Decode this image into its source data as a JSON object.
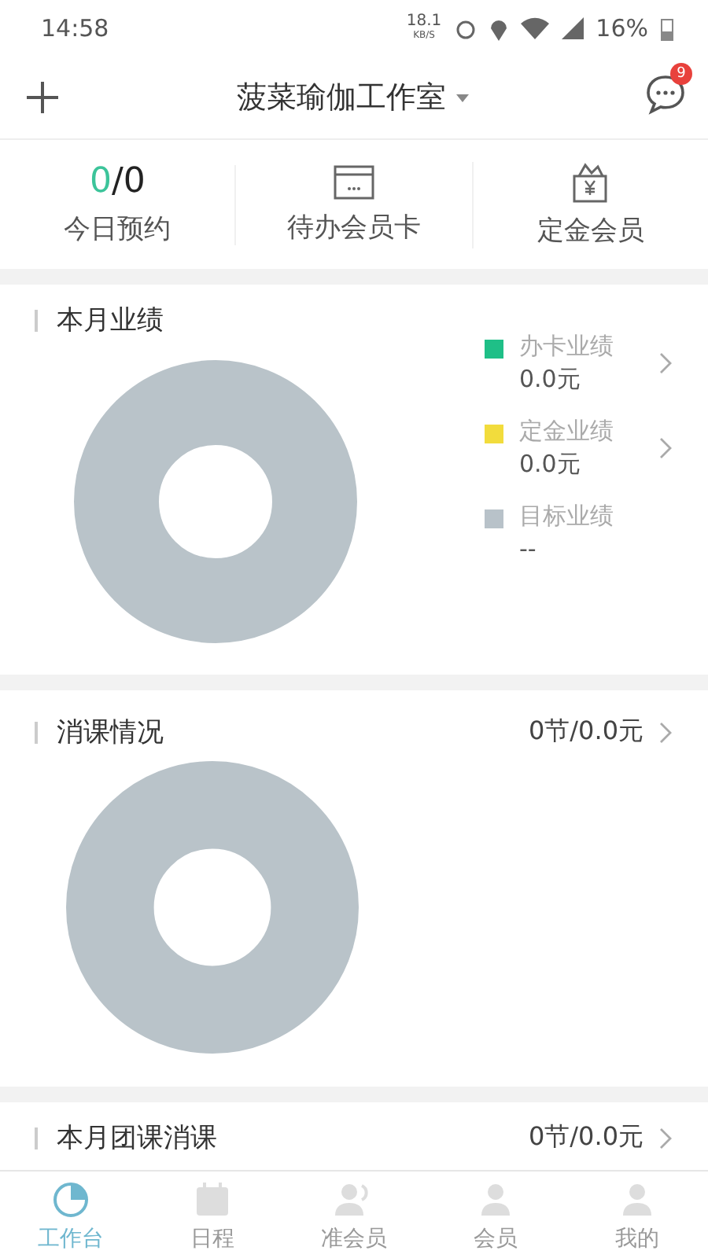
{
  "status_bar": {
    "time": "14:58",
    "speed": "18.1",
    "speed_unit": "KB/S",
    "battery": "16%"
  },
  "header": {
    "title": "菠菜瑜伽工作室",
    "badge": "9"
  },
  "stats": [
    {
      "kind": "count",
      "done": "0",
      "total": "/0",
      "label": "今日预约"
    },
    {
      "kind": "card",
      "label": "待办会员卡"
    },
    {
      "kind": "deposit",
      "label": "定金会员"
    }
  ],
  "sales": {
    "title": "本月业绩",
    "legend": [
      {
        "label": "办卡业绩",
        "value": "0.0元",
        "color": "#1fbf87",
        "link": true
      },
      {
        "label": "定金业绩",
        "value": "0.0元",
        "color": "#f2dc3c",
        "link": true
      },
      {
        "label": "目标业绩",
        "value": "--",
        "color": "#b8c2c9",
        "link": false
      }
    ]
  },
  "consumption": {
    "title": "消课情况",
    "summary": "0节/0.0元"
  },
  "group": {
    "title": "本月团课消课",
    "summary": "0节/0.0元"
  },
  "tabbar": [
    {
      "label": "工作台",
      "selected": true
    },
    {
      "label": "日程",
      "selected": false
    },
    {
      "label": "准会员",
      "selected": false
    },
    {
      "label": "会员",
      "selected": false
    },
    {
      "label": "我的",
      "selected": false
    }
  ]
}
